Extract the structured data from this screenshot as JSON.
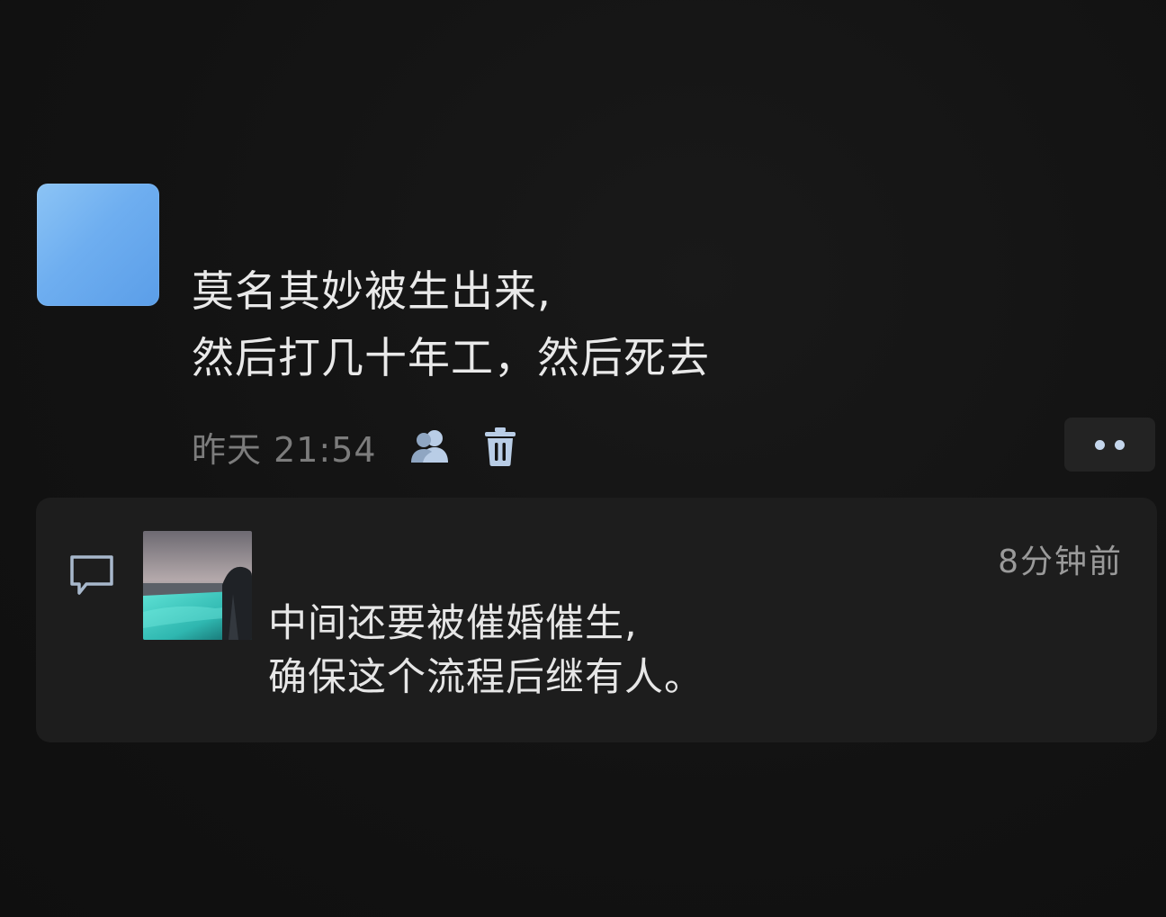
{
  "post": {
    "text_lines": [
      "莫名其妙被生出来,",
      "然后打几十年工，然后死去"
    ],
    "timestamp": "昨天 21:54",
    "icons": {
      "visibility": "friends-icon",
      "delete": "trash-icon",
      "more": "more-dots-icon"
    }
  },
  "comment": {
    "icon": "comment-bubble-icon",
    "time": "8分钟前",
    "text_lines": [
      "中间还要被催婚催生,",
      "确保这个流程后继有人。"
    ]
  },
  "colors": {
    "background": "#131313",
    "avatar": "#6eaef0",
    "comment_box": "#1d1d1d",
    "accent_icon": "#c4d6ec"
  }
}
